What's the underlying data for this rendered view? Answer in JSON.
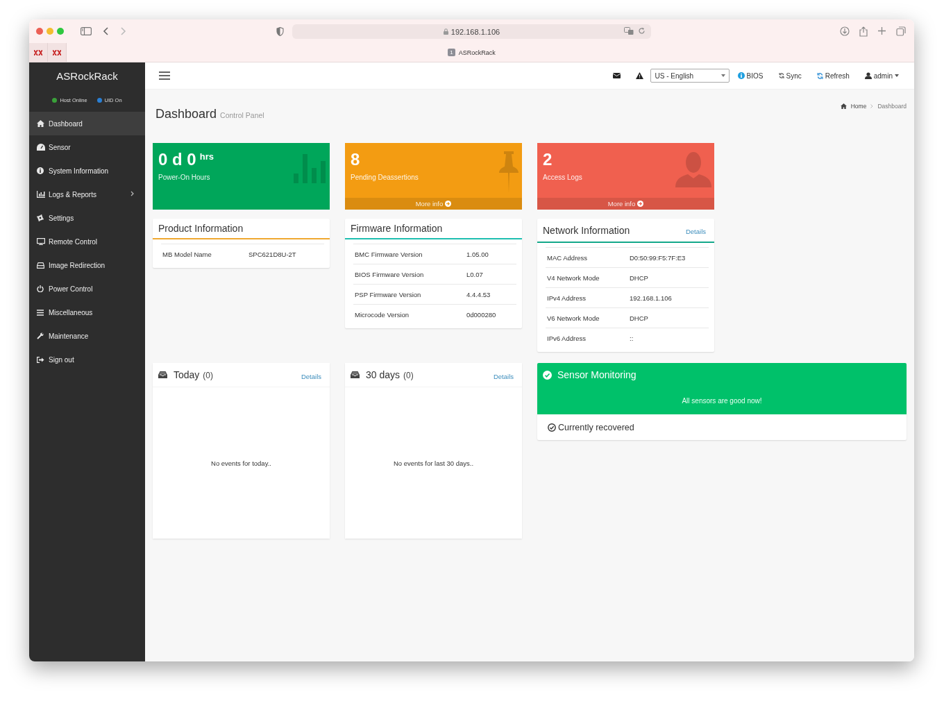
{
  "browser": {
    "url": "192.168.1.106",
    "tab_count": "1",
    "tab_title": "ASRockRack"
  },
  "sidebar": {
    "brand": "ASRockRack",
    "status": [
      {
        "label": "Host Online",
        "color": "#3aa13a"
      },
      {
        "label": "UID On",
        "color": "#2a7fd4"
      }
    ],
    "items": [
      {
        "label": "Dashboard",
        "selected": true,
        "expandable": false
      },
      {
        "label": "Sensor",
        "selected": false,
        "expandable": false
      },
      {
        "label": "System Information",
        "selected": false,
        "expandable": false
      },
      {
        "label": "Logs & Reports",
        "selected": false,
        "expandable": true
      },
      {
        "label": "Settings",
        "selected": false,
        "expandable": false
      },
      {
        "label": "Remote Control",
        "selected": false,
        "expandable": false
      },
      {
        "label": "Image Redirection",
        "selected": false,
        "expandable": false
      },
      {
        "label": "Power Control",
        "selected": false,
        "expandable": false
      },
      {
        "label": "Miscellaneous",
        "selected": false,
        "expandable": false
      },
      {
        "label": "Maintenance",
        "selected": false,
        "expandable": false
      },
      {
        "label": "Sign out",
        "selected": false,
        "expandable": false
      }
    ]
  },
  "header": {
    "language": "US - English",
    "links": [
      {
        "label": "BIOS"
      },
      {
        "label": "Sync"
      },
      {
        "label": "Refresh"
      },
      {
        "label": "admin"
      }
    ]
  },
  "page": {
    "title": "Dashboard",
    "subtitle": "Control Panel",
    "breadcrumb": [
      "Home",
      "Dashboard"
    ]
  },
  "stat_boxes": [
    {
      "value": "0 d 0",
      "unit": "hrs",
      "label": "Power-On Hours",
      "color": "#00a65a"
    },
    {
      "value": "8",
      "label": "Pending Deassertions",
      "color": "#f39c12",
      "more_info": "More info"
    },
    {
      "value": "2",
      "label": "Access Logs",
      "color": "#f0604f",
      "more_info": "More info"
    }
  ],
  "info_panels": [
    {
      "title": "Product Information",
      "color": "#f0a830",
      "rows": [
        [
          "MB Model Name",
          "SPC621D8U-2T"
        ]
      ]
    },
    {
      "title": "Firmware Information",
      "color": "#1fbfb0",
      "rows": [
        [
          "BMC Firmware Version",
          "1.05.00"
        ],
        [
          "BIOS Firmware Version",
          "L0.07"
        ],
        [
          "PSP Firmware Version",
          "4.4.4.53"
        ],
        [
          "Microcode Version",
          "0d000280"
        ]
      ]
    },
    {
      "title": "Network Information",
      "color": "#14a88a",
      "details": "Details",
      "rows": [
        [
          "MAC Address",
          "D0:50:99:F5:7F:E3"
        ],
        [
          "V4 Network Mode",
          "DHCP"
        ],
        [
          "IPv4 Address",
          "192.168.1.106"
        ],
        [
          "V6 Network Mode",
          "DHCP"
        ],
        [
          "IPv6 Address",
          "::"
        ]
      ]
    }
  ],
  "event_panels": [
    {
      "title": "Today",
      "count": "(0)",
      "details": "Details",
      "message": "No events for today.."
    },
    {
      "title": "30 days",
      "count": "(0)",
      "details": "Details",
      "message": "No events for last 30 days.."
    }
  ],
  "sensor_monitoring": {
    "title": "Sensor Monitoring",
    "message": "All sensors are good now!",
    "status": "Currently recovered"
  }
}
